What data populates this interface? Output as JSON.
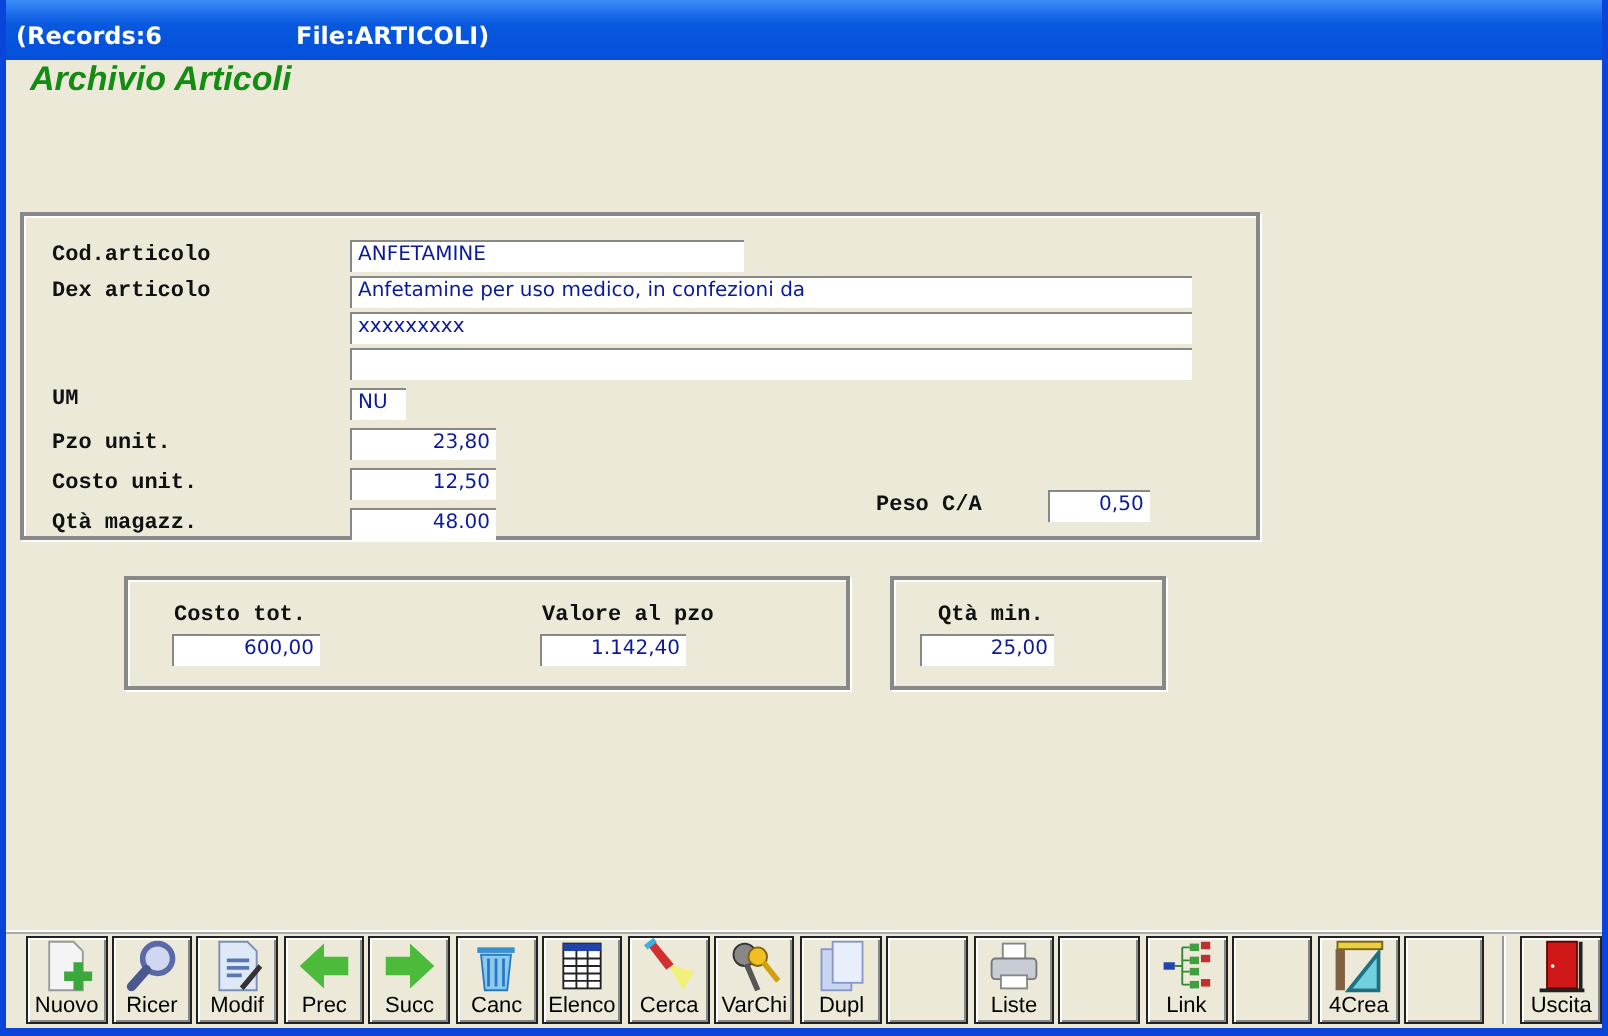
{
  "window": {
    "title_records": "(Records:6",
    "title_file": "File:ARTICOLI)"
  },
  "heading": "Archivio Articoli",
  "main_fields": [
    {
      "label": "Cod.articolo",
      "values": [
        "ANFETAMINE"
      ],
      "kind": "code"
    },
    {
      "label": "Dex articolo",
      "values": [
        "Anfetamine per uso medico, in confezioni da",
        "xxxxxxxxx"
      ],
      "kind": "description"
    },
    {
      "label": "UM",
      "values": [
        "NU"
      ],
      "kind": "unit"
    },
    {
      "label": "Pzo unit.",
      "values": [
        "23,80"
      ],
      "kind": "number"
    },
    {
      "label": "Costo unit.",
      "values": [
        "12,50"
      ],
      "kind": "number"
    },
    {
      "label": "Qtà magazz.",
      "values": [
        "48.00"
      ],
      "kind": "number"
    }
  ],
  "peso": {
    "label": "Peso C/A",
    "value": "0,50"
  },
  "totals": [
    {
      "label": "Costo tot.",
      "value": "600,00"
    },
    {
      "label": "Valore al pzo",
      "value": "1.142,40"
    }
  ],
  "minimum": {
    "label": "Qtà min.",
    "value": "25,00"
  },
  "toolbar": [
    {
      "label": "Nuovo",
      "kind": "new"
    },
    {
      "label": "Ricer",
      "kind": "search"
    },
    {
      "label": "Modif",
      "kind": "edit"
    },
    {
      "label": "Prec",
      "kind": "prev"
    },
    {
      "label": "Succ",
      "kind": "next"
    },
    {
      "label": "Canc",
      "kind": "delete"
    },
    {
      "label": "Elenco",
      "kind": "list"
    },
    {
      "label": "Cerca",
      "kind": "find"
    },
    {
      "label": "VarChi",
      "kind": "keys"
    },
    {
      "label": "Dupl",
      "kind": "duplicate"
    },
    {
      "kind": "blank"
    },
    {
      "label": "Liste",
      "kind": "print"
    },
    {
      "kind": "blank"
    },
    {
      "label": "Link",
      "kind": "link"
    },
    {
      "kind": "blank"
    },
    {
      "label": "4Crea",
      "kind": "tools"
    },
    {
      "kind": "blank"
    },
    {
      "label": "Uscita",
      "kind": "exit"
    }
  ]
}
